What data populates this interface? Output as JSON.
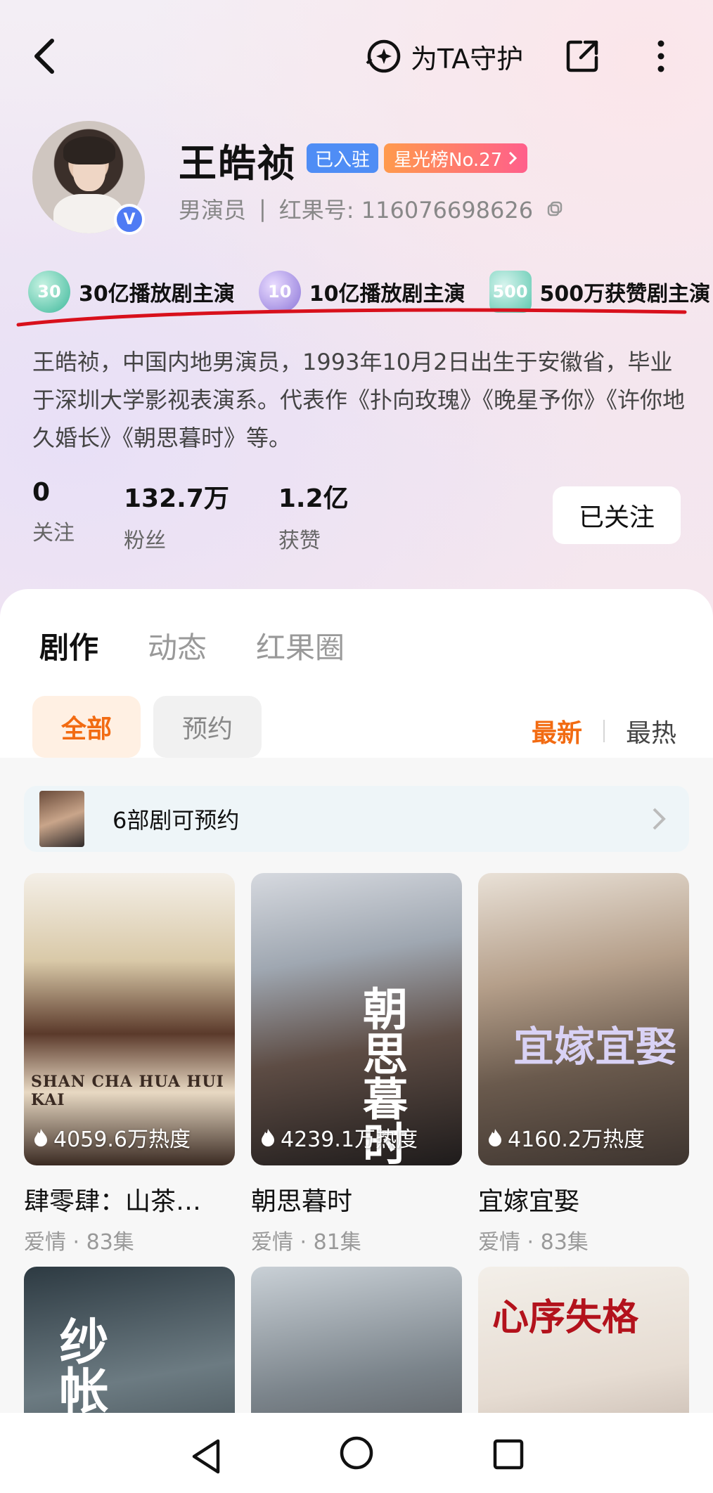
{
  "header": {
    "guard_label": "为TA守护"
  },
  "profile": {
    "name": "王皓祯",
    "badge_joined": "已入驻",
    "badge_star": "星光榜No.27",
    "role": "男演员",
    "divider": "|",
    "id_label": "红果号: 116076698626",
    "verified_mark": "V"
  },
  "honors": [
    {
      "badge_text": "30",
      "label": "30亿播放剧主演"
    },
    {
      "badge_text": "10",
      "label": "10亿播放剧主演"
    },
    {
      "badge_text": "500",
      "label": "500万获赞剧主演"
    }
  ],
  "bio": "王皓祯，中国内地男演员，1993年10月2日出生于安徽省，毕业于深圳大学影视表演系。代表作《扑向玫瑰》《晚星予你》《许你地久婚长》《朝思暮时》等。",
  "stats": [
    {
      "value": "0",
      "label": "关注"
    },
    {
      "value": "132.7万",
      "label": "粉丝"
    },
    {
      "value": "1.2亿",
      "label": "获赞"
    }
  ],
  "follow_button": "已关注",
  "tabs": [
    "剧作",
    "动态",
    "红果圈"
  ],
  "filters": {
    "all": "全部",
    "reserve": "预约"
  },
  "sort": {
    "newest": "最新",
    "hottest": "最热"
  },
  "reserve_banner": "6部剧可预约",
  "dramas": [
    {
      "title": "肆零肆：山茶…",
      "meta": "爱情 · 83集",
      "heat": "4059.6万热度",
      "poster_text": "SHAN CHA HUA HUI KAI"
    },
    {
      "title": "朝思暮时",
      "meta": "爱情 · 81集",
      "heat": "4239.1万热度",
      "poster_text": "朝思暮时"
    },
    {
      "title": "宜嫁宜娶",
      "meta": "爱情 · 83集",
      "heat": "4160.2万热度",
      "poster_text": "宜嫁宜娶"
    },
    {
      "title": "",
      "meta": "",
      "heat": "",
      "poster_text": "纱帐"
    },
    {
      "title": "",
      "meta": "",
      "heat": "",
      "poster_text": ""
    },
    {
      "title": "",
      "meta": "",
      "heat": "",
      "poster_text": "心序失格"
    }
  ],
  "colors": {
    "accent_orange": "#f26b12",
    "badge_blue": "#4f8df5",
    "annotation_red": "#d8101c"
  }
}
